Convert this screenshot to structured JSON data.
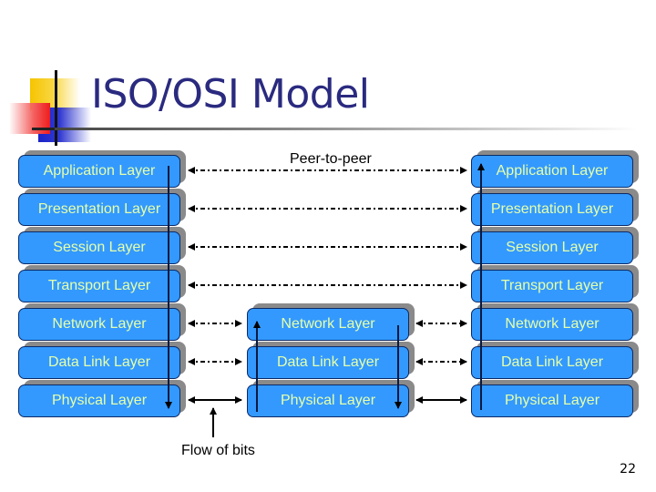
{
  "slide": {
    "title": "ISO/OSI Model",
    "page_number": "22"
  },
  "labels": {
    "peer_to_peer": "Peer-to-peer",
    "flow_of_bits": "Flow of bits"
  },
  "colors": {
    "layer_fill": "#3399ff",
    "layer_text": "#e6ffa8",
    "layer_shadow": "#8a8a8a",
    "title": "#2a2a80"
  },
  "stacks": {
    "left": [
      "Application Layer",
      "Presentation Layer",
      "Session Layer",
      "Transport Layer",
      "Network Layer",
      "Data Link Layer",
      "Physical Layer"
    ],
    "middle": [
      "Network Layer",
      "Data Link Layer",
      "Physical Layer"
    ],
    "right": [
      "Application Layer",
      "Presentation Layer",
      "Session Layer",
      "Transport Layer",
      "Network Layer",
      "Data Link Layer",
      "Physical Layer"
    ]
  }
}
